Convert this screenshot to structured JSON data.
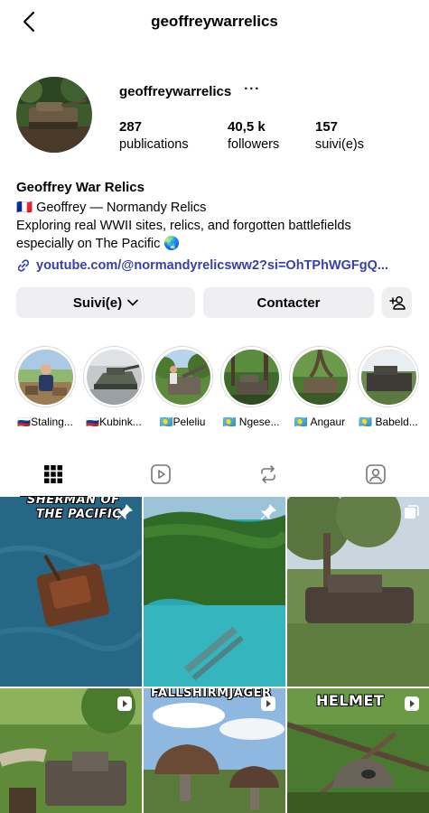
{
  "header": {
    "title": "geoffreywarrelics"
  },
  "profile": {
    "username": "geoffreywarrelics",
    "more": "···",
    "stats": [
      {
        "value": "287",
        "label": "publications"
      },
      {
        "value": "40,5 k",
        "label": "followers"
      },
      {
        "value": "157",
        "label": "suivi(e)s"
      }
    ],
    "display_name": "Geoffrey War Relics",
    "bio_line1": "🇫🇷 Geoffrey — Normandy Relics",
    "bio_line2": "Exploring real WWII sites, relics, and forgotten battlefields",
    "bio_line3": "especially on The Pacific 🌏",
    "link": "youtube.com/@normandyrelicsww2?si=OhTPhWGFgQ..."
  },
  "actions": {
    "follow_label": "Suivi(e)",
    "contact_label": "Contacter"
  },
  "highlights": [
    {
      "label": "🇷🇺Staling..."
    },
    {
      "label": "🇷🇺Kubink..."
    },
    {
      "label": "🇵🇼Peleliu"
    },
    {
      "label": "🇵🇼 Ngese..."
    },
    {
      "label": "🇵🇼 Angaur"
    },
    {
      "label": "🇵🇼 Babeld..."
    }
  ],
  "posts": [
    {
      "overlay_line1": "SHERMAN OF",
      "overlay_line2": "THE PACIFIC",
      "badge": "pin-icon"
    },
    {
      "badge": "pin-icon"
    },
    {
      "badge": "carousel-icon"
    },
    {
      "badge": "reel-icon"
    },
    {
      "overlay": "FALLSHIRMJAGER",
      "badge": "reel-icon"
    },
    {
      "overlay": "HELMET",
      "badge": "reel-icon"
    }
  ],
  "colors": {
    "link": "#3740a8",
    "button_bg": "#efeff1"
  }
}
